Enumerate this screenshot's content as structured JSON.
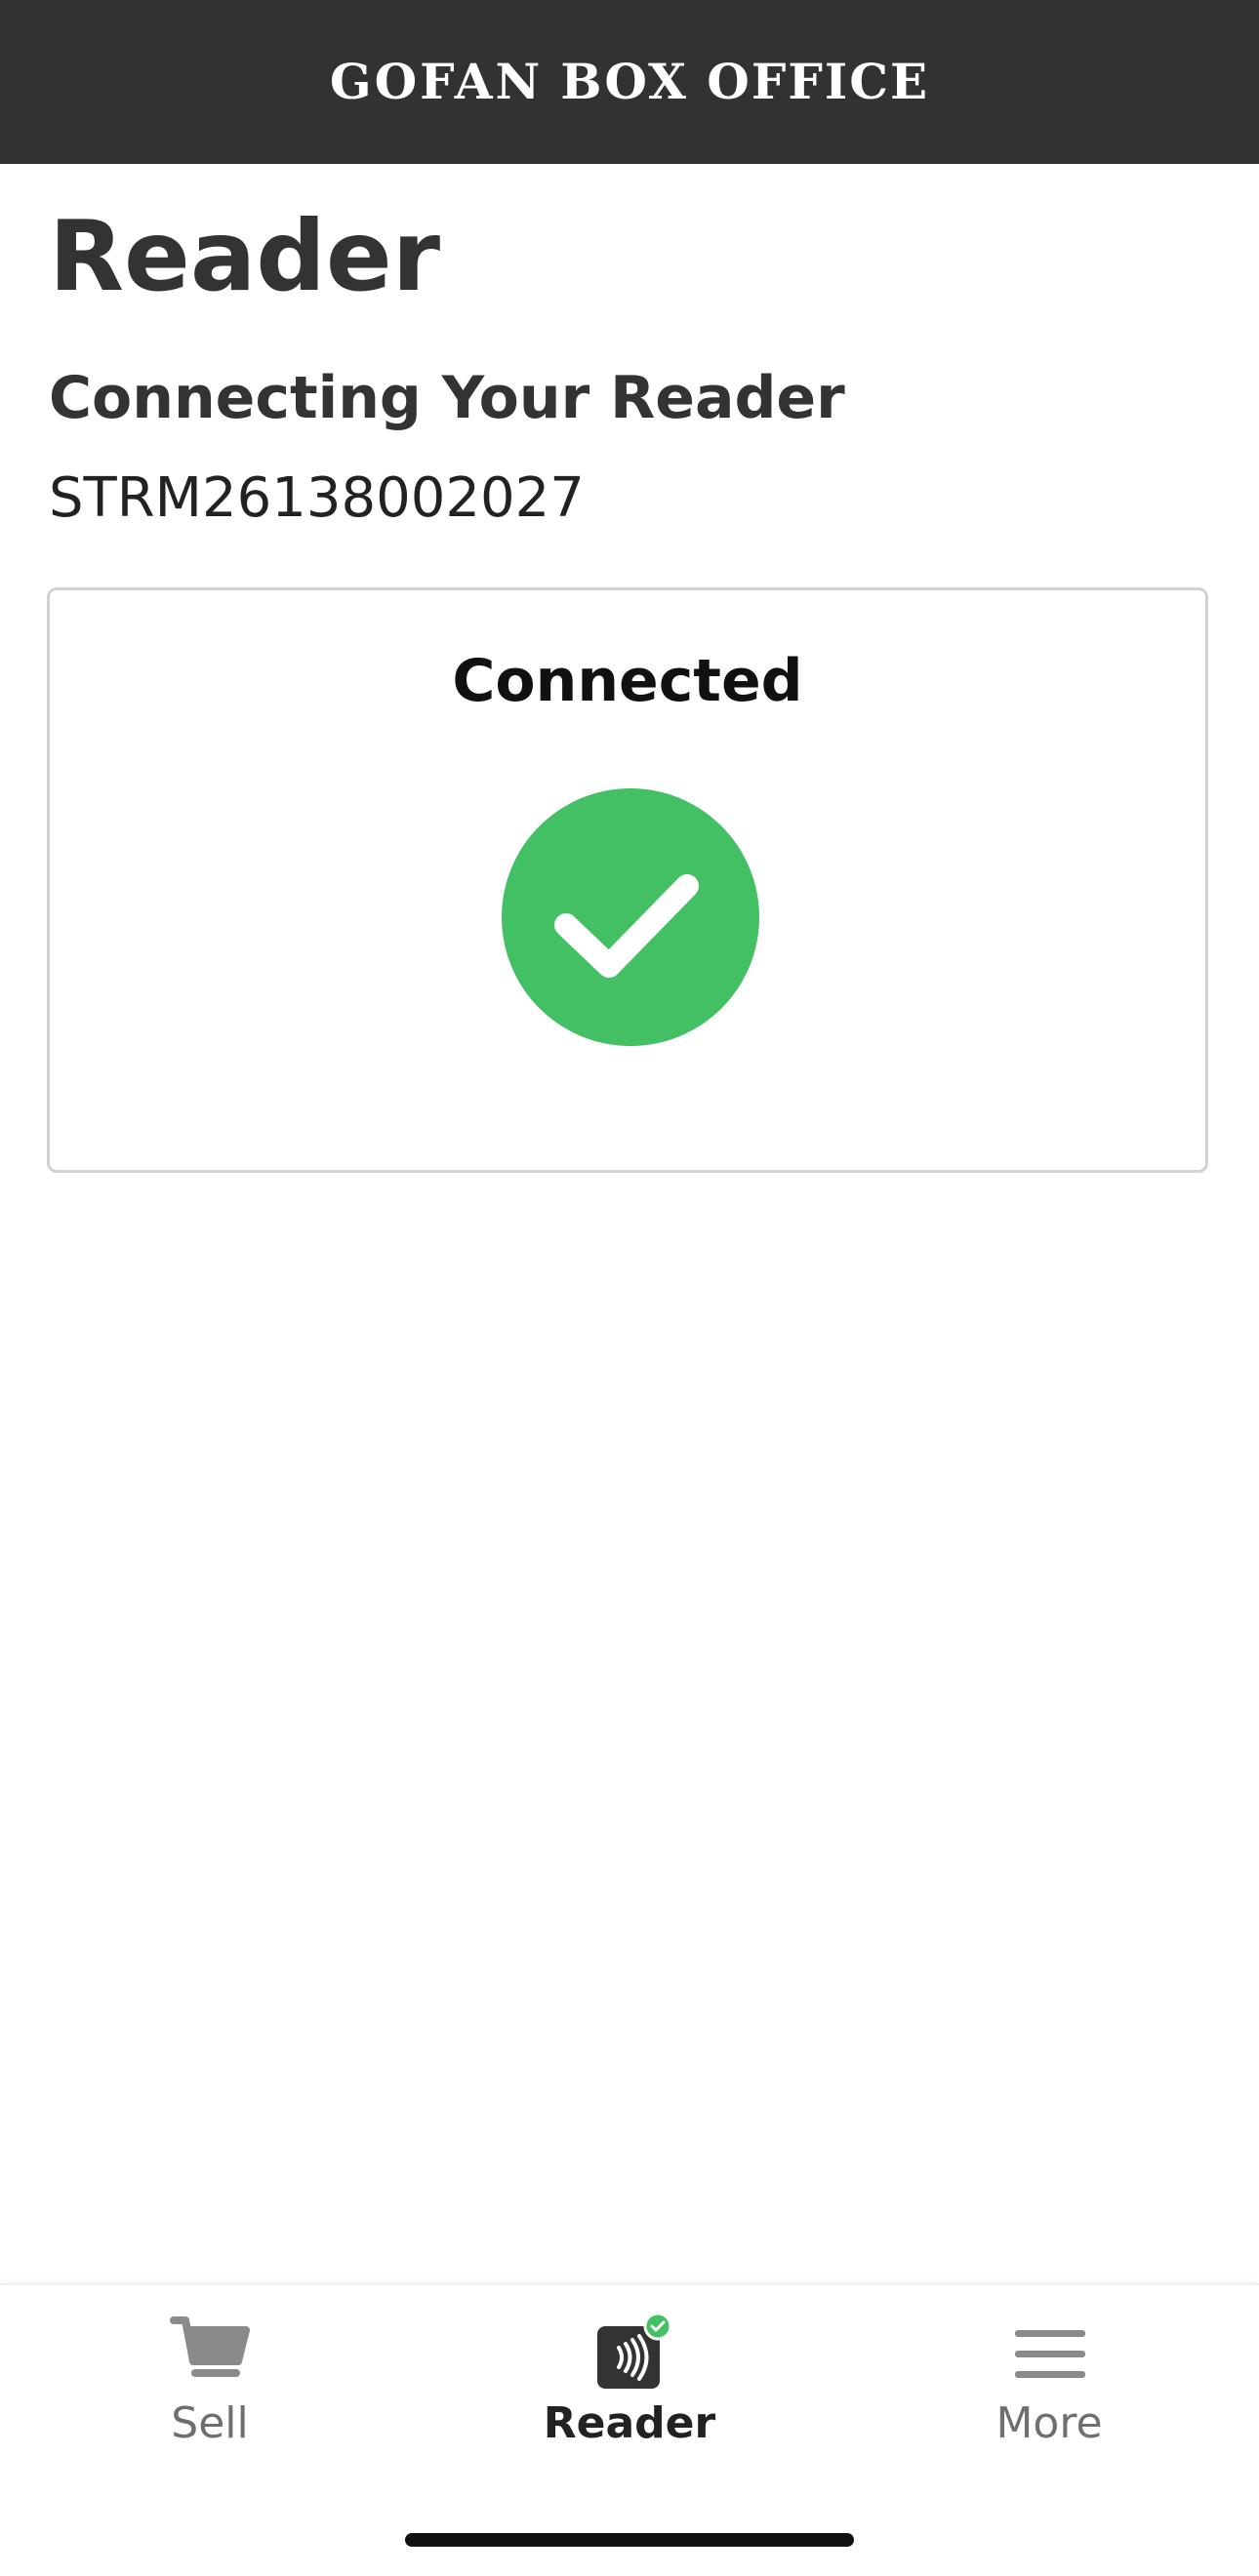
{
  "header": {
    "logo_text": "GOFAN",
    "title": "BOX OFFICE"
  },
  "page": {
    "title": "Reader",
    "section_title": "Connecting Your Reader",
    "serial": "STRM26138002027"
  },
  "status_card": {
    "label": "Connected",
    "icon": "check-circle-icon",
    "color": "#44c064"
  },
  "tabs": [
    {
      "label": "Sell",
      "icon": "cart-icon",
      "active": false
    },
    {
      "label": "Reader",
      "icon": "contactless-reader-icon",
      "active": true,
      "badge": "check-badge-icon"
    },
    {
      "label": "More",
      "icon": "menu-icon",
      "active": false
    }
  ],
  "colors": {
    "header_bg": "#323232",
    "success": "#44c064",
    "text": "#333333",
    "inactive": "#6f6f6f"
  }
}
